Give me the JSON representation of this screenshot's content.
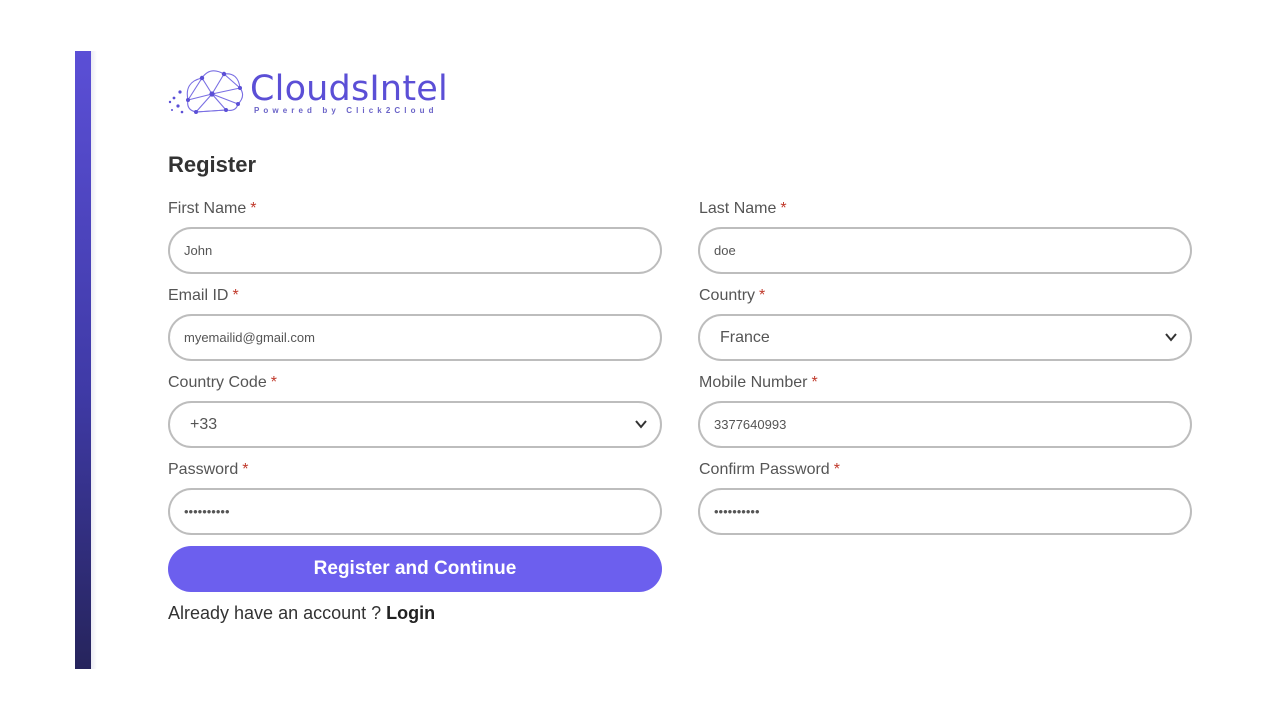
{
  "brand": {
    "name": "CloudsIntel",
    "tagline": "Powered by Click2Cloud",
    "color": "#5b4fd6",
    "icon": "cloud-network-logo-icon"
  },
  "form": {
    "title": "Register",
    "required_marker": "*",
    "first_name": {
      "label": "First Name",
      "value": "John"
    },
    "last_name": {
      "label": "Last Name",
      "value": "doe"
    },
    "email": {
      "label": "Email ID",
      "value": "myemailid@gmail.com"
    },
    "country": {
      "label": "Country",
      "value": "France"
    },
    "country_code": {
      "label": "Country Code",
      "value": "+33"
    },
    "mobile": {
      "label": "Mobile Number",
      "value": "3377640993"
    },
    "password": {
      "label": "Password",
      "value": "••••••••••"
    },
    "confirm_password": {
      "label": "Confirm Password",
      "value": "••••••••••"
    },
    "submit_label": "Register and Continue",
    "submit_color": "#6c5fee",
    "login_prompt": "Already have an account ?",
    "login_link": "Login"
  }
}
